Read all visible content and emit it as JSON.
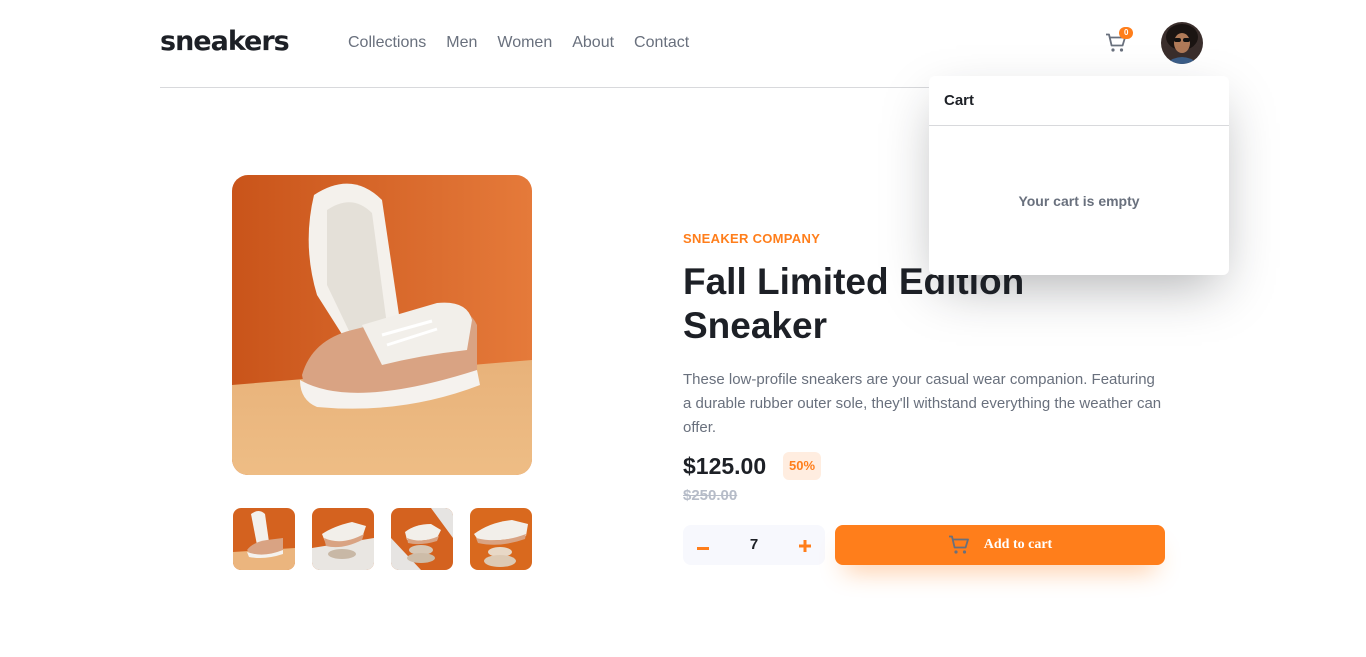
{
  "brand": {
    "logo": "sneakers"
  },
  "nav": {
    "items": [
      "Collections",
      "Men",
      "Women",
      "About",
      "Contact"
    ]
  },
  "header": {
    "cart_count": "0",
    "cart_icon": "cart-icon",
    "avatar_icon": "avatar"
  },
  "cart_popup": {
    "title": "Cart",
    "empty_message": "Your cart is empty"
  },
  "product": {
    "company": "SNEAKER COMPANY",
    "title": "Fall Limited Edition Sneaker",
    "description": "These low-profile sneakers are your casual wear companion. Featuring a durable rubber outer sole, they'll withstand everything the weather can offer.",
    "price": "$125.00",
    "discount": "50%",
    "original_price": "$250.00"
  },
  "quantity": {
    "minus": "−",
    "value": "7",
    "plus": "+"
  },
  "add_to_cart": {
    "label": "Add to cart",
    "icon": "cart-icon"
  },
  "colors": {
    "accent": "#ff7e1b",
    "accent_light": "#ffede0",
    "text_dark": "#1d2026",
    "text_gray": "#69707d",
    "text_light": "#b6bcc8"
  }
}
